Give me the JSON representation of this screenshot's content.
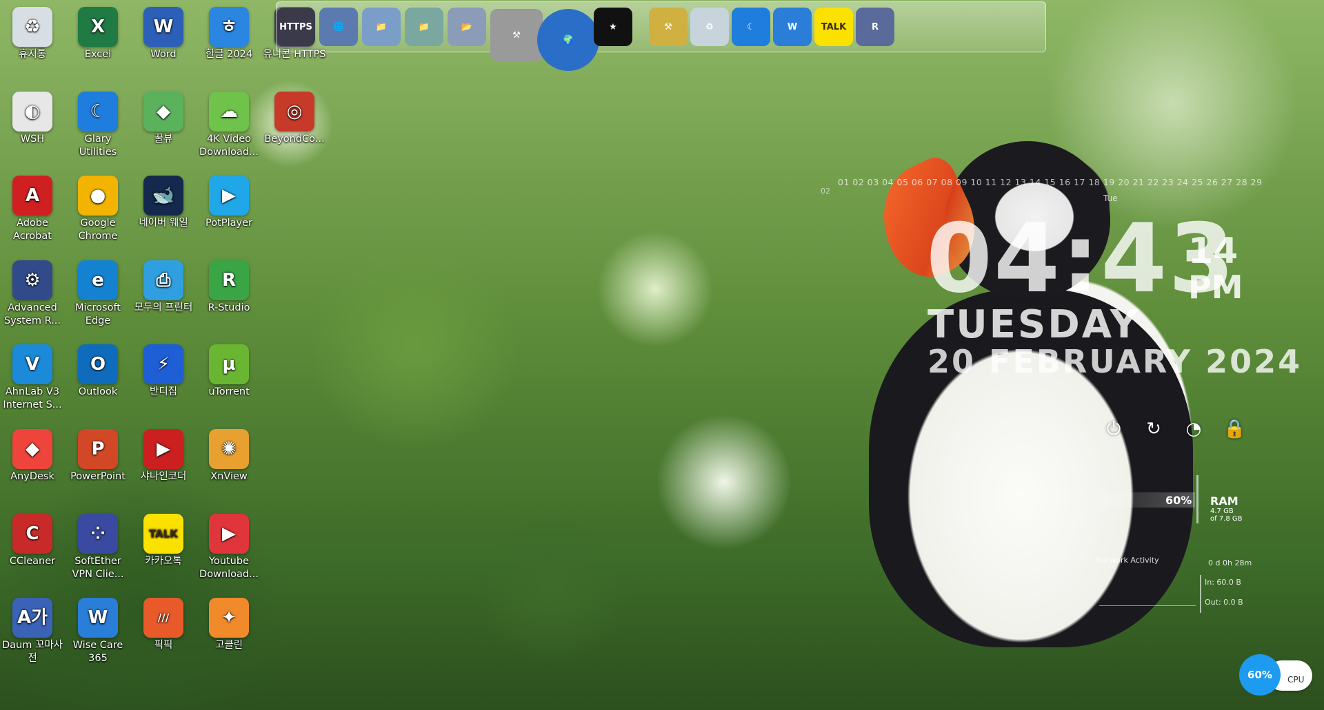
{
  "desktop_icons": [
    {
      "label": "휴지통",
      "glyph": "♻",
      "color": "#d7dfe5",
      "col": 0,
      "row": 0
    },
    {
      "label": "Excel",
      "glyph": "X",
      "color": "#1f7a43",
      "col": 1,
      "row": 0
    },
    {
      "label": "Word",
      "glyph": "W",
      "color": "#2b5fb8",
      "col": 2,
      "row": 0
    },
    {
      "label": "한글 2024",
      "glyph": "ㅎ",
      "color": "#2a86e0",
      "col": 3,
      "row": 0
    },
    {
      "label": "유니콘 HTTPS",
      "glyph": "🦄",
      "color": "#3a3a4a",
      "col": 4,
      "row": 0
    },
    {
      "label": "WSH",
      "glyph": "◐",
      "color": "#e7e7e7",
      "col": 0,
      "row": 1
    },
    {
      "label": "Glary Utilities",
      "glyph": "☾",
      "color": "#1e7ddd",
      "col": 1,
      "row": 1
    },
    {
      "label": "꿀뷰",
      "glyph": "◆",
      "color": "#5ab25d",
      "col": 2,
      "row": 1
    },
    {
      "label": "4K Video Download...",
      "glyph": "☁",
      "color": "#6fc24a",
      "col": 3,
      "row": 1
    },
    {
      "label": "BeyondCo...",
      "glyph": "◎",
      "color": "#c73a2a",
      "col": 4,
      "row": 1
    },
    {
      "label": "Adobe Acrobat",
      "glyph": "A",
      "color": "#d01f20",
      "col": 0,
      "row": 2
    },
    {
      "label": "Google Chrome",
      "glyph": "●",
      "color": "#f2b400",
      "col": 1,
      "row": 2
    },
    {
      "label": "네이버 웨일",
      "glyph": "🐋",
      "color": "#14294d",
      "col": 2,
      "row": 2
    },
    {
      "label": "PotPlayer",
      "glyph": "▶",
      "color": "#1fa7e8",
      "col": 3,
      "row": 2
    },
    {
      "label": "Advanced System R...",
      "glyph": "⚙",
      "color": "#304a8a",
      "col": 0,
      "row": 3
    },
    {
      "label": "Microsoft Edge",
      "glyph": "e",
      "color": "#1482d1",
      "col": 1,
      "row": 3
    },
    {
      "label": "모두의 프린터",
      "glyph": "⎙",
      "color": "#2f9fe0",
      "col": 2,
      "row": 3
    },
    {
      "label": "R-Studio",
      "glyph": "R",
      "color": "#3aa545",
      "col": 3,
      "row": 3
    },
    {
      "label": "AhnLab V3 Internet S...",
      "glyph": "V",
      "color": "#1b8ad8",
      "col": 0,
      "row": 4
    },
    {
      "label": "Outlook",
      "glyph": "O",
      "color": "#0f6cbd",
      "col": 1,
      "row": 4
    },
    {
      "label": "반디집",
      "glyph": "⚡",
      "color": "#1e5fd6",
      "col": 2,
      "row": 4
    },
    {
      "label": "uTorrent",
      "glyph": "µ",
      "color": "#6ab632",
      "col": 3,
      "row": 4
    },
    {
      "label": "AnyDesk",
      "glyph": "◆",
      "color": "#ef443b",
      "col": 0,
      "row": 5
    },
    {
      "label": "PowerPoint",
      "glyph": "P",
      "color": "#d24726",
      "col": 1,
      "row": 5
    },
    {
      "label": "샤나인코더",
      "glyph": "▶",
      "color": "#cc2020",
      "col": 2,
      "row": 5
    },
    {
      "label": "XnView",
      "glyph": "✺",
      "color": "#e8a030",
      "col": 3,
      "row": 5
    },
    {
      "label": "CCleaner",
      "glyph": "C",
      "color": "#c82a2a",
      "col": 0,
      "row": 6
    },
    {
      "label": "SoftEther VPN Clie...",
      "glyph": "⁘",
      "color": "#3a4aa0",
      "col": 1,
      "row": 6
    },
    {
      "label": "카카오톡",
      "glyph": "TALK",
      "color": "#fae100",
      "col": 2,
      "row": 6
    },
    {
      "label": "Youtube Download...",
      "glyph": "▶",
      "color": "#e0353a",
      "col": 3,
      "row": 6
    },
    {
      "label": "Daum 꼬마사전",
      "glyph": "A가",
      "color": "#3a63b8",
      "col": 0,
      "row": 7
    },
    {
      "label": "Wise Care 365",
      "glyph": "W",
      "color": "#2a7ed8",
      "col": 1,
      "row": 7
    },
    {
      "label": "픽픽",
      "glyph": "///",
      "color": "#e85a2a",
      "col": 2,
      "row": 7
    },
    {
      "label": "고클린",
      "glyph": "✦",
      "color": "#f08a2a",
      "col": 3,
      "row": 7
    }
  ],
  "dock_items": [
    {
      "name": "unicorn-dock",
      "glyph": "HTTPS",
      "color": "#3a3a4a"
    },
    {
      "name": "globe-network",
      "glyph": "🌐",
      "color": "#5a7ab0"
    },
    {
      "name": "folder-1",
      "glyph": "📁",
      "color": "#7a9ec8"
    },
    {
      "name": "folder-2",
      "glyph": "📁",
      "color": "#7aa8a0"
    },
    {
      "name": "folder-3",
      "glyph": "📂",
      "color": "#8a9cb8"
    },
    {
      "name": "dev-tools",
      "glyph": "⚒",
      "color": "#9a9a9a"
    },
    {
      "name": "earth",
      "glyph": "🌍",
      "color": "#2a6ec8"
    },
    {
      "name": "tshirt",
      "glyph": "★",
      "color": "#111111"
    },
    {
      "name": "tools",
      "glyph": "⚒",
      "color": "#d0b040"
    },
    {
      "name": "recycle-bin",
      "glyph": "♻",
      "color": "#c8d4dc"
    },
    {
      "name": "glary",
      "glyph": "☾",
      "color": "#1e7ddd"
    },
    {
      "name": "wise-care",
      "glyph": "W",
      "color": "#2a7ed8"
    },
    {
      "name": "kakao-talk",
      "glyph": "TALK",
      "color": "#fae100"
    },
    {
      "name": "r-backup",
      "glyph": "R",
      "color": "#5a6a9a"
    }
  ],
  "clock": {
    "calendar_days": "01 02 03 04 05 06 07 08 09 10 11 12 13 14 15 16 17 18 19 20 21 22 23 24 25 26 27 28 29",
    "month_num": "02",
    "day_abbrev": "Tue",
    "time": "04:43",
    "seconds": "14",
    "ampm": "PM",
    "weekday": "TUESDAY",
    "date": "20 FEBRUARY   2024"
  },
  "ram": {
    "percent": "60%",
    "label": "RAM",
    "used": "4.7 GB",
    "total": "of 7.8 GB"
  },
  "network": {
    "title": "Network Activity",
    "uptime": "0 d 0h 28m",
    "in": "In: 60.0 B",
    "out": "Out: 0.0 B"
  },
  "cpu": {
    "percent": "60%",
    "label": "CPU"
  }
}
